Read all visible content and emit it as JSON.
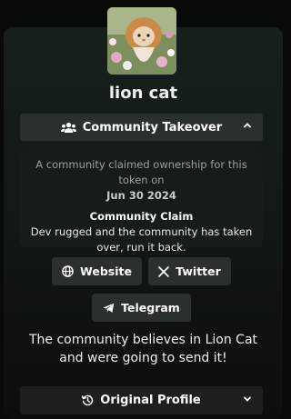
{
  "token": {
    "name": "lion cat",
    "avatar_icon": "lion-cat-image"
  },
  "takeover": {
    "label": "Community Takeover",
    "icon": "users-icon",
    "toggle_icon": "chevron-up-icon",
    "claim_text": "A community claimed ownership for this token on",
    "claim_date": "Jun 30 2024",
    "claim_heading": "Community Claim",
    "claim_body": "Dev rugged and the community has taken over, run it back."
  },
  "links": {
    "website": {
      "label": "Website",
      "icon": "globe-icon"
    },
    "twitter": {
      "label": "Twitter",
      "icon": "x-icon"
    },
    "telegram": {
      "label": "Telegram",
      "icon": "telegram-icon"
    }
  },
  "description": "The community believes in Lion Cat and were going to send it!",
  "original_profile": {
    "label": "Original Profile",
    "icon": "history-icon",
    "toggle_icon": "chevron-down-icon"
  },
  "colors": {
    "page_bg": "#080a09",
    "card_bg": "#17201c",
    "button_bg": "#2a302d",
    "muted_text": "#9aa09d"
  }
}
